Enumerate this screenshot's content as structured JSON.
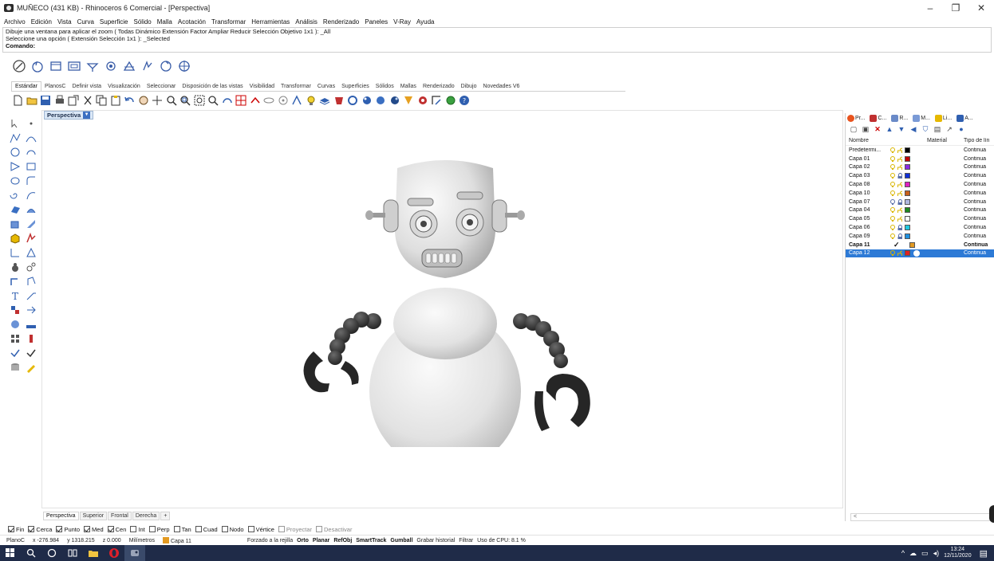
{
  "window": {
    "title": "MUÑECO (431 KB) - Rhinoceros 6 Comercial - [Perspectiva]",
    "controls": {
      "minimize": "–",
      "restore": "❐",
      "close": "✕"
    }
  },
  "menu": [
    "Archivo",
    "Edición",
    "Vista",
    "Curva",
    "Superficie",
    "Sólido",
    "Malla",
    "Acotación",
    "Transformar",
    "Herramientas",
    "Análisis",
    "Renderizado",
    "Paneles",
    "V-Ray",
    "Ayuda"
  ],
  "command": {
    "history": [
      "Dibuje una ventana para aplicar el zoom ( Todas Dinámico Extensión Factor Ampliar Reducir Selección Objetivo 1x1 ): _All",
      "Seleccione una opción ( Extensión Selección 1x1 ): _Selected"
    ],
    "prompt": "Comando:"
  },
  "toolbar_tabs": [
    "Estándar",
    "PlanosC",
    "Definir vista",
    "Visualización",
    "Seleccionar",
    "Disposición de las vistas",
    "Visibilidad",
    "Transformar",
    "Curvas",
    "Superficies",
    "Sólidos",
    "Mallas",
    "Renderizado",
    "Dibujo",
    "Novedades V6"
  ],
  "active_toolbar_tab": "Estándar",
  "viewport": {
    "label": "Perspectiva",
    "arrow": "▼",
    "tabs": [
      "Perspectiva",
      "Superior",
      "Frontal",
      "Derecha"
    ],
    "add_tab": "+"
  },
  "osnaps": [
    {
      "label": "Fin",
      "checked": true
    },
    {
      "label": "Cerca",
      "checked": true
    },
    {
      "label": "Punto",
      "checked": true
    },
    {
      "label": "Med",
      "checked": true
    },
    {
      "label": "Cen",
      "checked": true
    },
    {
      "label": "Int",
      "checked": false
    },
    {
      "label": "Perp",
      "checked": false
    },
    {
      "label": "Tan",
      "checked": false
    },
    {
      "label": "Cuad",
      "checked": false
    },
    {
      "label": "Nodo",
      "checked": false
    },
    {
      "label": "Vértice",
      "checked": false
    },
    {
      "label": "Proyectar",
      "checked": false
    },
    {
      "label": "Desactivar",
      "checked": false
    }
  ],
  "status": {
    "cplane": "PlanoC",
    "x": "x -276.984",
    "y": "y 1318.215",
    "z": "z 0.000",
    "units": "Milímetros",
    "layer": "Capa 11",
    "grid_snap": "Forzado a la rejilla",
    "ortho": "Orto",
    "planar": "Planar",
    "osnap": "RefObj",
    "smarttrack": "SmartTrack",
    "gumball": "Gumball",
    "history": "Grabar historial",
    "filter": "Filtrar",
    "cpu": "Uso de CPU: 8.1 %"
  },
  "taskbar": {
    "time": "13:24",
    "date": "12/11/2020"
  },
  "panel": {
    "tabs": [
      "Pr...",
      "C...",
      "R...",
      "M...",
      "Li...",
      "A..."
    ],
    "headers": {
      "name": "Nombre",
      "material": "Material",
      "linetype": "Tipo de lín"
    },
    "layers": [
      {
        "name": "Predetermi...",
        "color": "#000000",
        "locked": false,
        "bulb": "#d9b600",
        "linetype": "Continua"
      },
      {
        "name": "Capa 01",
        "color": "#c00000",
        "locked": false,
        "bulb": "#d9b600",
        "linetype": "Continua"
      },
      {
        "name": "Capa 02",
        "color": "#8a2be2",
        "locked": false,
        "bulb": "#d9b600",
        "linetype": "Continua"
      },
      {
        "name": "Capa 03",
        "color": "#1030d8",
        "locked": true,
        "bulb": "#d9b600",
        "linetype": "Continua"
      },
      {
        "name": "Capa 08",
        "color": "#e020c0",
        "locked": false,
        "bulb": "#d9b600",
        "linetype": "Continua"
      },
      {
        "name": "Capa 10",
        "color": "#c8601a",
        "locked": false,
        "bulb": "#d9b600",
        "linetype": "Continua"
      },
      {
        "name": "Capa 07",
        "color": "#b0b8e0",
        "locked": true,
        "bulb": "#5a6fa8",
        "linetype": "Continua"
      },
      {
        "name": "Capa 04",
        "color": "#1e8a1e",
        "locked": false,
        "bulb": "#d9b600",
        "linetype": "Continua"
      },
      {
        "name": "Capa 05",
        "color": "#ffffff",
        "locked": false,
        "bulb": "#d9b600",
        "linetype": "Continua"
      },
      {
        "name": "Capa 06",
        "color": "#20c8e0",
        "locked": true,
        "bulb": "#d9b600",
        "linetype": "Continua"
      },
      {
        "name": "Capa 09",
        "color": "#2090e0",
        "locked": true,
        "bulb": "#d9b600",
        "linetype": "Continua"
      },
      {
        "name": "Capa 11",
        "color": "#e39a22",
        "current": true,
        "linetype": "Continua"
      },
      {
        "name": "Capa 12",
        "color": "#e02020",
        "selected": true,
        "locked": false,
        "bulb": "#d9b600",
        "linetype": "Continua"
      }
    ],
    "current_mark": "✓",
    "scroll_left": "<"
  }
}
